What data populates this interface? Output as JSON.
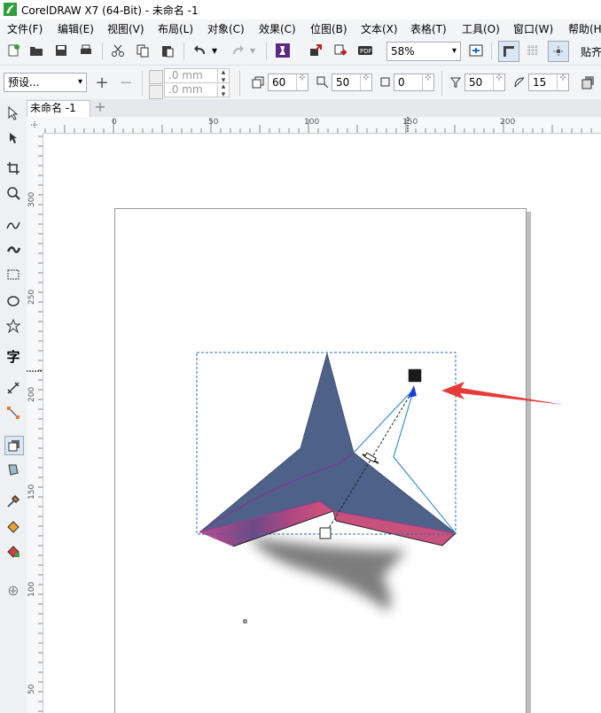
{
  "window": {
    "title": "CorelDRAW X7 (64-Bit) - 未命名 -1"
  },
  "menu": [
    "文件(F)",
    "编辑(E)",
    "视图(V)",
    "布局(L)",
    "对象(C)",
    "效果(C)",
    "位图(B)",
    "文本(X)",
    "表格(T)",
    "工具(O)",
    "窗口(W)",
    "帮助(H"
  ],
  "toolbar": {
    "zoom": "58%",
    "snap_label": "贴齐"
  },
  "propertybar": {
    "preset": "预设...",
    "width_value": ".0 mm",
    "height_value": ".0 mm",
    "depth": "60",
    "vanishing": "50",
    "rotation": "0",
    "bevel_depth": "50",
    "bevel_angle": "15"
  },
  "doc_tab": {
    "name": "未命名 -1",
    "add": "+"
  },
  "ruler": {
    "horizontal": [
      "0",
      "50",
      "100",
      "150",
      "200"
    ],
    "vertical": [
      "300",
      "250",
      "200",
      "150",
      "100",
      "50"
    ]
  },
  "colors": {
    "object_fill": "#4e6188",
    "extrude_side": "#8e3f7e",
    "vector_line": "#1a7fc7",
    "vanish_handle": "#1a3fd8"
  }
}
